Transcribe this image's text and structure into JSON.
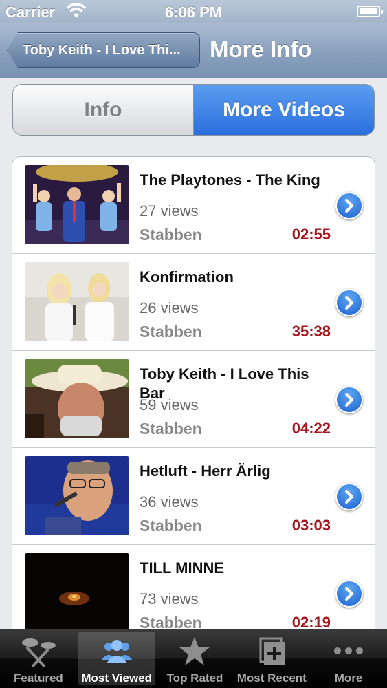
{
  "status_bar": {
    "carrier": "Carrier",
    "time": "6:06 PM"
  },
  "nav": {
    "back_label": "Toby Keith - I Love Thi...",
    "title": "More Info"
  },
  "segmented": {
    "info_label": "Info",
    "more_videos_label": "More Videos",
    "selected": "More Videos"
  },
  "videos": [
    {
      "title": "The Playtones - The King",
      "views": "27 views",
      "author": "Stabben",
      "duration": "02:55",
      "thumb": "stage-performance"
    },
    {
      "title": "Konfirmation",
      "views": "26 views",
      "author": "Stabben",
      "duration": "35:38",
      "thumb": "two-singers"
    },
    {
      "title": "Toby Keith - I Love This Bar",
      "views": "59 views",
      "author": "Stabben",
      "duration": "04:22",
      "thumb": "cowboy-hat-man"
    },
    {
      "title": "Hetluft - Herr Ärlig",
      "views": "36 views",
      "author": "Stabben",
      "duration": "03:03",
      "thumb": "singer-with-glasses"
    },
    {
      "title": "TILL MINNE",
      "views": "73 views",
      "author": "Stabben",
      "duration": "02:19",
      "thumb": "dark-candle"
    }
  ],
  "tabs": [
    {
      "label": "Featured",
      "icon": "featured-icon",
      "selected": false
    },
    {
      "label": "Most Viewed",
      "icon": "people-icon",
      "selected": true
    },
    {
      "label": "Top Rated",
      "icon": "star-icon",
      "selected": false
    },
    {
      "label": "Most Recent",
      "icon": "recent-icon",
      "selected": false
    },
    {
      "label": "More",
      "icon": "more-dots-icon",
      "selected": false
    }
  ],
  "colors": {
    "accent_blue": "#2a6fdd",
    "duration_red": "#a3161c",
    "nav_blue": "#7891b1"
  }
}
